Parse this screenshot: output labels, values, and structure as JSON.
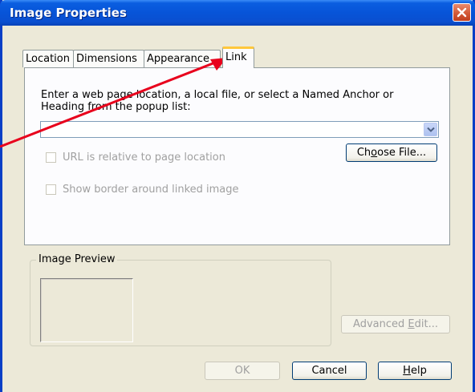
{
  "window": {
    "title": "Image Properties"
  },
  "tabs": [
    {
      "label": "Location"
    },
    {
      "label": "Dimensions"
    },
    {
      "label": "Appearance"
    },
    {
      "label": "Link",
      "active": true
    }
  ],
  "link_tab": {
    "instruction_line1": "Enter a web page location, a local file, or select a Named Anchor or",
    "instruction_line2": "Heading from the popup list:",
    "url_value": "",
    "url_relative_label": "URL is relative to page location",
    "show_border_label": "Show border around linked image",
    "choose_file_pre": "Ch",
    "choose_file_u": "o",
    "choose_file_post": "ose File..."
  },
  "preview": {
    "group_title": "Image Preview"
  },
  "buttons": {
    "advanced_pre": "Advanced ",
    "advanced_u": "E",
    "advanced_post": "dit...",
    "ok": "OK",
    "cancel": "Cancel",
    "help_u": "H",
    "help_post": "elp"
  },
  "colors": {
    "title_bar": "#0754d8",
    "close_button": "#d35a38",
    "active_tab_highlight": "#ffc83c",
    "annotation_arrow": "#e8001c"
  },
  "icons": {
    "close": "close-icon",
    "dropdown": "chevron-down-icon"
  }
}
